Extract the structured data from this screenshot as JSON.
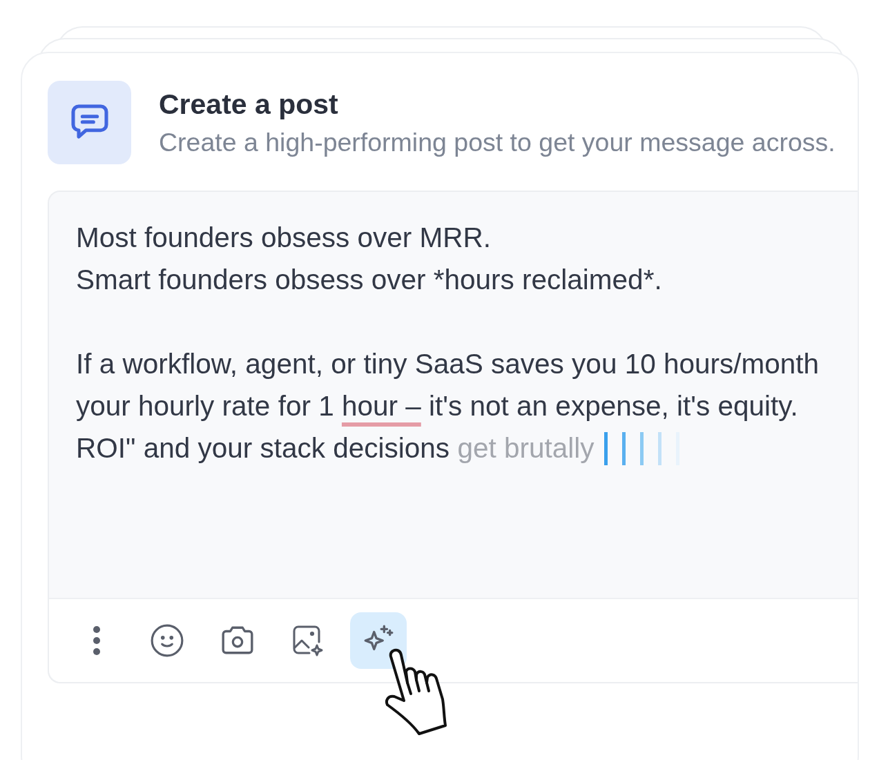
{
  "header": {
    "title": "Create a post",
    "subtitle": "Create a high-performing post to get your message across."
  },
  "editor": {
    "lines": [
      {
        "kind": "text",
        "segments": [
          {
            "kind": "plain",
            "text": "Most founders obsess over MRR."
          }
        ]
      },
      {
        "kind": "text",
        "segments": [
          {
            "kind": "plain",
            "text": "Smart founders obsess over *hours reclaimed*."
          }
        ]
      },
      {
        "kind": "blank"
      },
      {
        "kind": "text",
        "segments": [
          {
            "kind": "plain",
            "text": "If a workflow, agent, or tiny SaaS saves you 10 hours/month"
          }
        ]
      },
      {
        "kind": "text",
        "segments": [
          {
            "kind": "plain",
            "text": "your hourly rate for 1 "
          },
          {
            "kind": "flagged",
            "text": "hour –"
          },
          {
            "kind": "plain",
            "text": " it's not an expense, it's equity."
          }
        ]
      },
      {
        "kind": "text",
        "segments": [
          {
            "kind": "plain",
            "text": "ROI\" and your stack decisions "
          },
          {
            "kind": "suggestion",
            "text": "get brutally"
          }
        ],
        "typing": true
      }
    ]
  },
  "toolbar": [
    {
      "kind": "more",
      "selected": false
    },
    {
      "kind": "emoji",
      "selected": false
    },
    {
      "kind": "camera",
      "selected": false
    },
    {
      "kind": "image",
      "selected": false
    },
    {
      "kind": "ai",
      "selected": true
    }
  ]
}
